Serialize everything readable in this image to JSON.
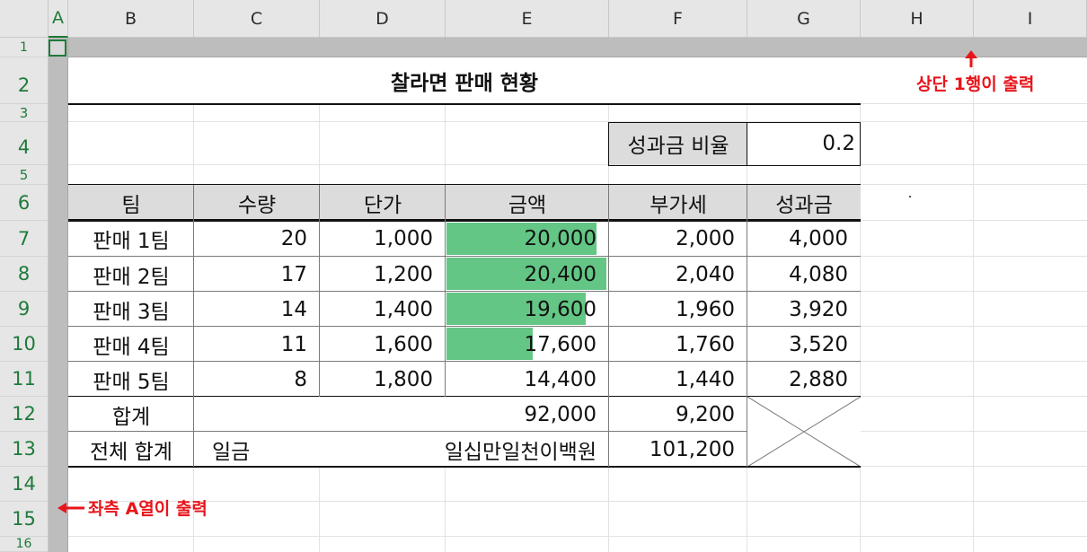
{
  "columns": [
    "A",
    "B",
    "C",
    "D",
    "E",
    "F",
    "G",
    "H",
    "I"
  ],
  "rows": [
    "1",
    "2",
    "3",
    "4",
    "5",
    "6",
    "7",
    "8",
    "9",
    "10",
    "11",
    "12",
    "13",
    "14",
    "15",
    "16"
  ],
  "title": "찰라면 판매 현황",
  "bonus_rate": {
    "label": "성과금 비율",
    "value": "0.2"
  },
  "table": {
    "headers": [
      "팀",
      "수량",
      "단가",
      "금액",
      "부가세",
      "성과금"
    ],
    "rows": [
      {
        "team": "판매 1팀",
        "qty": "20",
        "price": "1,000",
        "amount": "20,000",
        "vat": "2,000",
        "bonus": "4,000",
        "bar": 0.94
      },
      {
        "team": "판매 2팀",
        "qty": "17",
        "price": "1,200",
        "amount": "20,400",
        "vat": "2,040",
        "bonus": "4,080",
        "bar": 1.0
      },
      {
        "team": "판매 3팀",
        "qty": "14",
        "price": "1,400",
        "amount": "19,600",
        "vat": "1,960",
        "bonus": "3,920",
        "bar": 0.87
      },
      {
        "team": "판매 4팀",
        "qty": "11",
        "price": "1,600",
        "amount": "17,600",
        "vat": "1,760",
        "bonus": "3,520",
        "bar": 0.54
      },
      {
        "team": "판매 5팀",
        "qty": "8",
        "price": "1,800",
        "amount": "14,400",
        "vat": "1,440",
        "bonus": "2,880",
        "bar": 0
      }
    ],
    "total": {
      "label": "합계",
      "amount": "92,000",
      "vat": "9,200"
    },
    "grand_total": {
      "label": "전체 합계",
      "prefix": "일금",
      "words": "일십만일천이백원",
      "value": "101,200"
    }
  },
  "notes": {
    "top_row": "상단 1행이 출력",
    "left_col": "좌측 A열이 출력"
  },
  "colors": {
    "accent_green": "#1f7a3a",
    "databar": "#63c685",
    "note_red": "#e8141b"
  }
}
